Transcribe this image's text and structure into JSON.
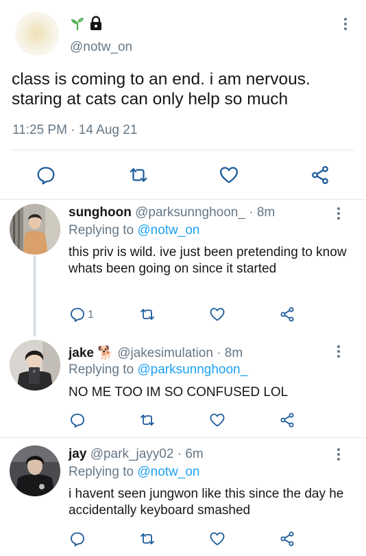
{
  "main_tweet": {
    "handle": "@notw_on",
    "text": "class is coming to an end. i am nervous. staring at cats can only help so much",
    "timestamp": "11:25 PM · 14 Aug 21",
    "name_icons": [
      "seedling-icon",
      "lock-icon"
    ]
  },
  "replies": [
    {
      "name": "sunghoon",
      "handle_time": "@parksunnghoon_ · 8m",
      "replying_label": "Replying to",
      "replying_to": "@notw_on",
      "text": "this priv is wild. ive just been pretending to know whats been going on since it started",
      "reply_count": "1"
    },
    {
      "name": "jake",
      "emoji": "🐕",
      "handle_time": "@jakesimulation · 8m",
      "replying_label": "Replying to",
      "replying_to": "@parksunnghoon_",
      "text": "NO ME TOO IM SO CONFUSED LOL",
      "reply_count": ""
    },
    {
      "name": "jay",
      "handle_time": "@park_jayy02 · 6m",
      "replying_label": "Replying to",
      "replying_to": "@notw_on",
      "text": "i havent seen jungwon like this since the day he accidentally keyboard smashed",
      "reply_count": ""
    }
  ],
  "colors": {
    "text": "#14171a",
    "secondary": "#657786",
    "link": "#1da1f2",
    "divider": "#e1e8ed",
    "icon": "#1b5a9a",
    "seedling": "#4caf50"
  }
}
